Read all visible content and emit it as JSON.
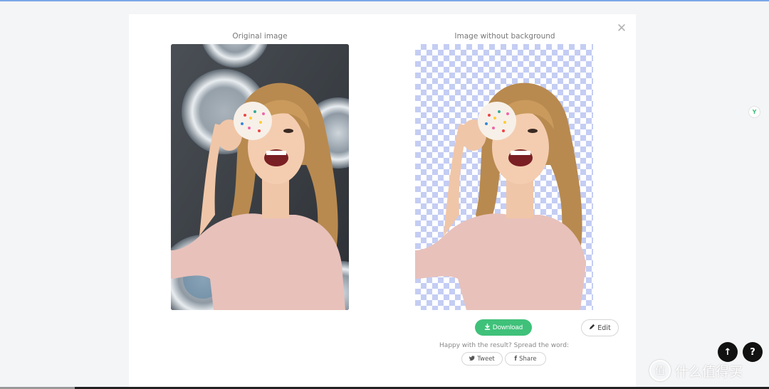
{
  "modal": {
    "close_glyph": "✕",
    "original_caption": "Original image",
    "result_caption": "Image without background"
  },
  "actions": {
    "download_icon": "download-icon",
    "download_label": "Download",
    "edit_icon": "pencil-icon",
    "edit_label": "Edit",
    "happy_text": "Happy with the result? Spread the word:",
    "tweet_icon": "twitter-icon",
    "tweet_label": "Tweet",
    "share_icon": "facebook-icon",
    "share_label": "Share"
  },
  "floating": {
    "up_glyph": "↑",
    "help_glyph": "?",
    "side_badge_glyph": "Y"
  },
  "watermark": {
    "icon_glyph": "值",
    "text": "什么值得买"
  },
  "colors": {
    "accent_green": "#3fc17a",
    "checker_blue": "#c4cdf3",
    "page_bg": "#f4f5f6"
  }
}
